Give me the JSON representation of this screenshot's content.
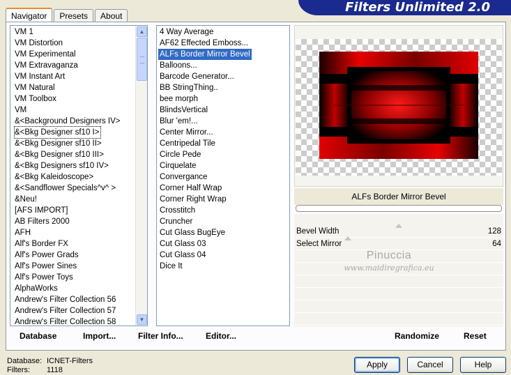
{
  "window": {
    "title": "Filters Unlimited 2.0"
  },
  "tabs": [
    {
      "label": "Navigator",
      "active": true
    },
    {
      "label": "Presets",
      "active": false
    },
    {
      "label": "About",
      "active": false
    }
  ],
  "categories": {
    "items": [
      "VM 1",
      "VM Distortion",
      "VM Experimental",
      "VM Extravaganza",
      "VM Instant Art",
      "VM Natural",
      "VM Toolbox",
      "VM",
      "&<Background Designers IV>",
      "&<Bkg Designer sf10 I>",
      "&<Bkg Designer sf10 II>",
      "&<Bkg Designer sf10 III>",
      "&<Bkg Designers sf10 IV>",
      "&<Bkg Kaleidoscope>",
      "&<Sandflower Specials^v^ >",
      "&Neu!",
      "[AFS IMPORT]",
      "AB Filters 2000",
      "AFH",
      "Alf's Border FX",
      "Alf's Power Grads",
      "Alf's Power Sines",
      "Alf's Power Toys",
      "AlphaWorks",
      "Andrew's Filter Collection 56",
      "Andrew's Filter Collection 57",
      "Andrew's Filter Collection 58"
    ],
    "selected_index": 9
  },
  "filters": {
    "items": [
      "4 Way Average",
      "AF62 Effected Emboss...",
      "ALFs Border Mirror Bevel",
      "Balloons...",
      "Barcode Generator...",
      "BB StringThing..",
      "bee morph",
      "BlindsVertical",
      "Blur 'em!...",
      "Center Mirror...",
      "Centripedal Tile",
      "Circle Pede",
      "Cirquelate",
      "Convergance",
      "Corner Half Wrap",
      "Corner Right Wrap",
      "Crosstitch",
      "Cruncher",
      "Cut Glass  BugEye",
      "Cut Glass 03",
      "Cut Glass 04",
      "Dice It"
    ],
    "selected_index": 2
  },
  "preview": {
    "filter_name": "ALFs Border Mirror Bevel",
    "colors": {
      "dark": "#000000",
      "red": "#e00000",
      "deep": "#6a0000"
    }
  },
  "params": [
    {
      "label": "Bevel Width",
      "value": "128"
    },
    {
      "label": "Select Mirror",
      "value": "64"
    }
  ],
  "watermark": {
    "name": "Pinuccia",
    "site": "www.maidiregrafica.eu"
  },
  "toolbar": {
    "database": "Database",
    "import": "Import...",
    "filter_info": "Filter Info...",
    "editor": "Editor...",
    "randomize": "Randomize",
    "reset": "Reset"
  },
  "status": {
    "database_label": "Database:",
    "database_value": "ICNET-Filters",
    "filters_label": "Filters:",
    "filters_value": "1118"
  },
  "buttons": {
    "apply": "Apply",
    "cancel": "Cancel",
    "help": "Help"
  }
}
